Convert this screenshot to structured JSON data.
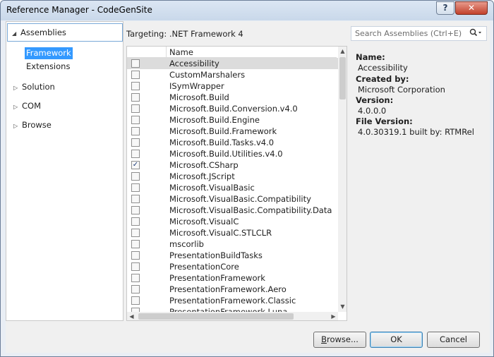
{
  "window": {
    "title": "Reference Manager - CodeGenSite",
    "help_glyph": "?",
    "close_glyph": "✕"
  },
  "nav": {
    "assemblies": "Assemblies",
    "framework": "Framework",
    "extensions": "Extensions",
    "solution": "Solution",
    "com": "COM",
    "browse": "Browse",
    "expanded_glyph": "◢",
    "collapsed_glyph": "▷"
  },
  "targeting": "Targeting: .NET Framework 4",
  "search": {
    "placeholder": "Search Assemblies (Ctrl+E)",
    "icon": "search-icon"
  },
  "list": {
    "header_name": "Name",
    "check_glyph": "✓",
    "rows": [
      {
        "name": "Accessibility",
        "checked": false,
        "selected": true
      },
      {
        "name": "CustomMarshalers",
        "checked": false,
        "selected": false
      },
      {
        "name": "ISymWrapper",
        "checked": false,
        "selected": false
      },
      {
        "name": "Microsoft.Build",
        "checked": false,
        "selected": false
      },
      {
        "name": "Microsoft.Build.Conversion.v4.0",
        "checked": false,
        "selected": false
      },
      {
        "name": "Microsoft.Build.Engine",
        "checked": false,
        "selected": false
      },
      {
        "name": "Microsoft.Build.Framework",
        "checked": false,
        "selected": false
      },
      {
        "name": "Microsoft.Build.Tasks.v4.0",
        "checked": false,
        "selected": false
      },
      {
        "name": "Microsoft.Build.Utilities.v4.0",
        "checked": false,
        "selected": false
      },
      {
        "name": "Microsoft.CSharp",
        "checked": true,
        "selected": false
      },
      {
        "name": "Microsoft.JScript",
        "checked": false,
        "selected": false
      },
      {
        "name": "Microsoft.VisualBasic",
        "checked": false,
        "selected": false
      },
      {
        "name": "Microsoft.VisualBasic.Compatibility",
        "checked": false,
        "selected": false
      },
      {
        "name": "Microsoft.VisualBasic.Compatibility.Data",
        "checked": false,
        "selected": false
      },
      {
        "name": "Microsoft.VisualC",
        "checked": false,
        "selected": false
      },
      {
        "name": "Microsoft.VisualC.STLCLR",
        "checked": false,
        "selected": false
      },
      {
        "name": "mscorlib",
        "checked": false,
        "selected": false
      },
      {
        "name": "PresentationBuildTasks",
        "checked": false,
        "selected": false
      },
      {
        "name": "PresentationCore",
        "checked": false,
        "selected": false
      },
      {
        "name": "PresentationFramework",
        "checked": false,
        "selected": false
      },
      {
        "name": "PresentationFramework.Aero",
        "checked": false,
        "selected": false
      },
      {
        "name": "PresentationFramework.Classic",
        "checked": false,
        "selected": false
      },
      {
        "name": "PresentationFramework.Luna",
        "checked": false,
        "selected": false
      }
    ]
  },
  "details": {
    "name_label": "Name:",
    "name_value": "Accessibility",
    "created_label": "Created by:",
    "created_value": "Microsoft Corporation",
    "version_label": "Version:",
    "version_value": "4.0.0.0",
    "file_version_label": "File Version:",
    "file_version_value": "4.0.30319.1 built by: RTMRel"
  },
  "buttons": {
    "browse_underlined": "B",
    "browse_rest": "rowse...",
    "ok": "OK",
    "cancel": "Cancel"
  }
}
